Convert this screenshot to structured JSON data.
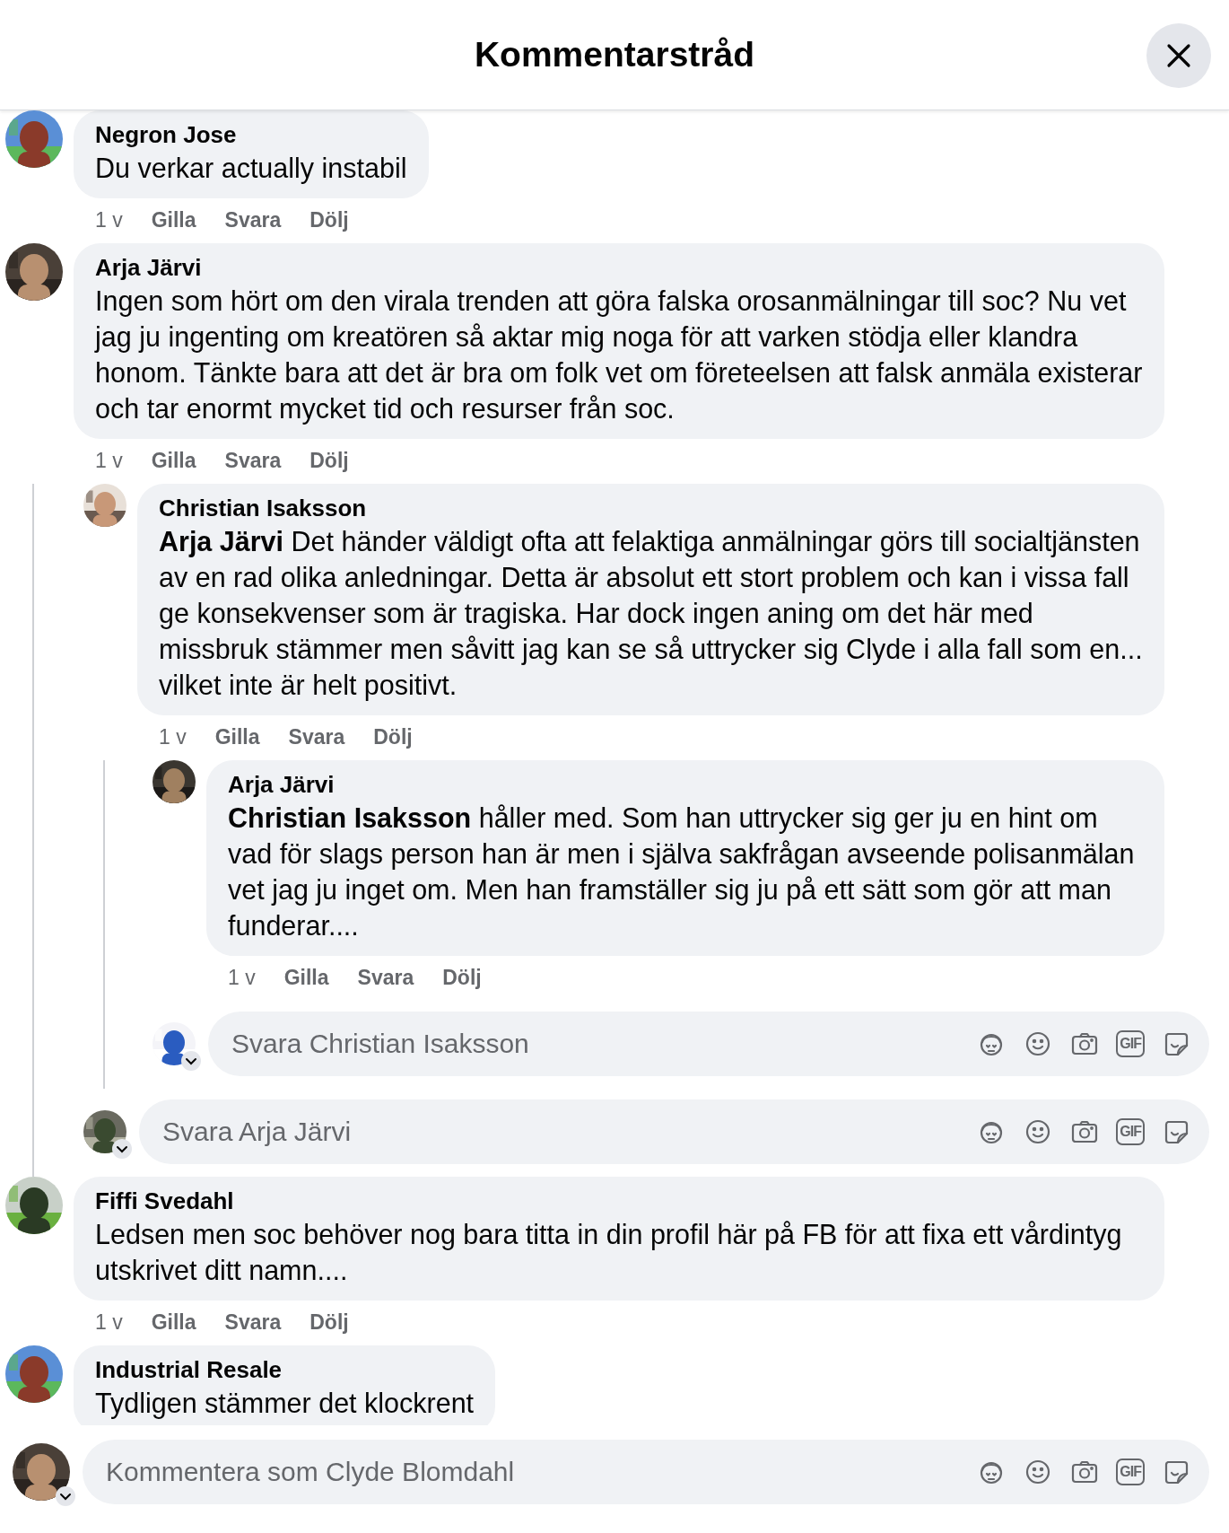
{
  "header": {
    "title": "Kommentarstråd"
  },
  "comments": [
    {
      "author": "Negron Jose",
      "text": "Du verkar actually instabil",
      "actions": [
        "1 v",
        "Gilla",
        "Svara",
        "Dölj"
      ]
    },
    {
      "author": "Arja Järvi",
      "text": "Ingen som hört om den virala trenden att göra falska orosanmälningar till soc? Nu vet jag ju ingenting om kreatören så aktar mig noga för att varken stödja eller klandra honom. Tänkte bara att det är bra om folk vet om företeelsen att falsk anmäla existerar och tar enormt mycket tid och resurser från soc.",
      "actions": [
        "1 v",
        "Gilla",
        "Svara",
        "Dölj"
      ],
      "children": [
        {
          "author": "Christian Isaksson",
          "text": "**Arja Järvi** Det händer väldigt ofta att felaktiga anmälningar görs till socialtjänsten av en rad olika anledningar. Detta är absolut ett stort problem och kan i vissa fall ge konsekvenser som är tragiska. Har dock ingen aning om det här med missbruk stämmer men såvitt jag kan se så uttrycker sig Clyde i alla fall som en... vilket inte är helt positivt.",
          "actions": [
            "1 v",
            "Gilla",
            "Svara",
            "Dölj"
          ],
          "children": [
            {
              "author": "Arja Järvi",
              "text": "**Christian Isaksson** håller med. Som han uttrycker sig ger ju en hint om vad för slags person han är men i själva sakfrågan avseende polisanmälan vet jag ju inget om. Men han framställer sig ju på ett sätt som gör att man funderar....",
              "actions": [
                "1 v",
                "Gilla",
                "Svara",
                "Dölj"
              ]
            }
          ],
          "reply_box": {
            "placeholder": "Svara Christian Isaksson",
            "gif": "GIF"
          }
        }
      ],
      "reply_box": {
        "placeholder": "Svara Arja Järvi",
        "gif": "GIF"
      }
    },
    {
      "author": "Fiffi Svedahl",
      "text": "Ledsen men soc behöver nog bara titta in din profil här på FB för att fixa ett vårdintyg utskrivet ditt namn....",
      "actions": [
        "1 v",
        "Gilla",
        "Svara",
        "Dölj"
      ]
    },
    {
      "author": "Industrial Resale",
      "text": "Tydligen stämmer det klockrent"
    }
  ],
  "composer": {
    "placeholder": "Kommentera som Clyde Blomdahl",
    "gif": "GIF"
  }
}
